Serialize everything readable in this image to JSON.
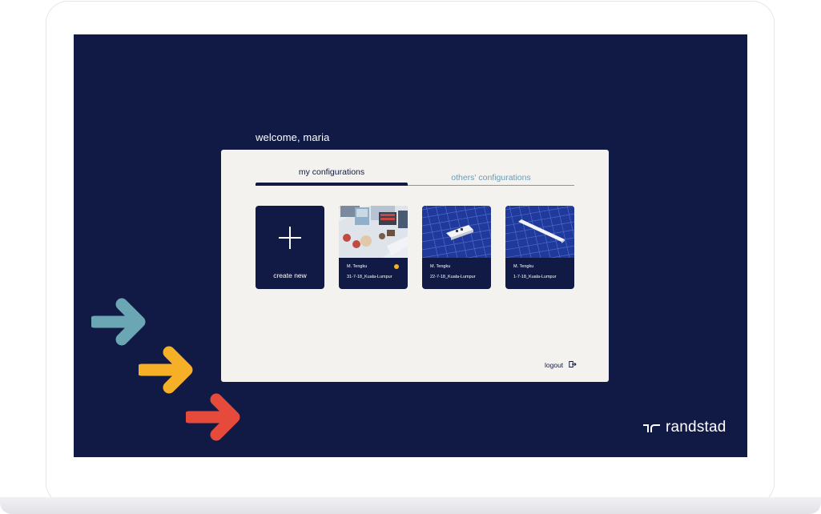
{
  "welcome": "welcome, maria",
  "tabs": {
    "mine": "my configurations",
    "others": "others' configurations"
  },
  "create": {
    "label": "create new",
    "icon": "plus-icon"
  },
  "configurations": [
    {
      "author": "M. Tengku",
      "name": "31-7-18_Kuala-Lumpur",
      "status_color": "#f5b027"
    },
    {
      "author": "M. Tengku",
      "name": "22-7-18_Kuala-Lumpur"
    },
    {
      "author": "M. Tengku",
      "name": "1-7-18_Kuala-Lumpur"
    }
  ],
  "logout": {
    "label": "logout",
    "icon": "logout-icon"
  },
  "brand": {
    "name": "randstad",
    "icon": "randstad-logo-icon"
  },
  "colors": {
    "navy": "#111a45",
    "panel": "#f4f2ee",
    "teal": "#6ba6b5",
    "yellow": "#f5b027",
    "red": "#e64a3b"
  }
}
